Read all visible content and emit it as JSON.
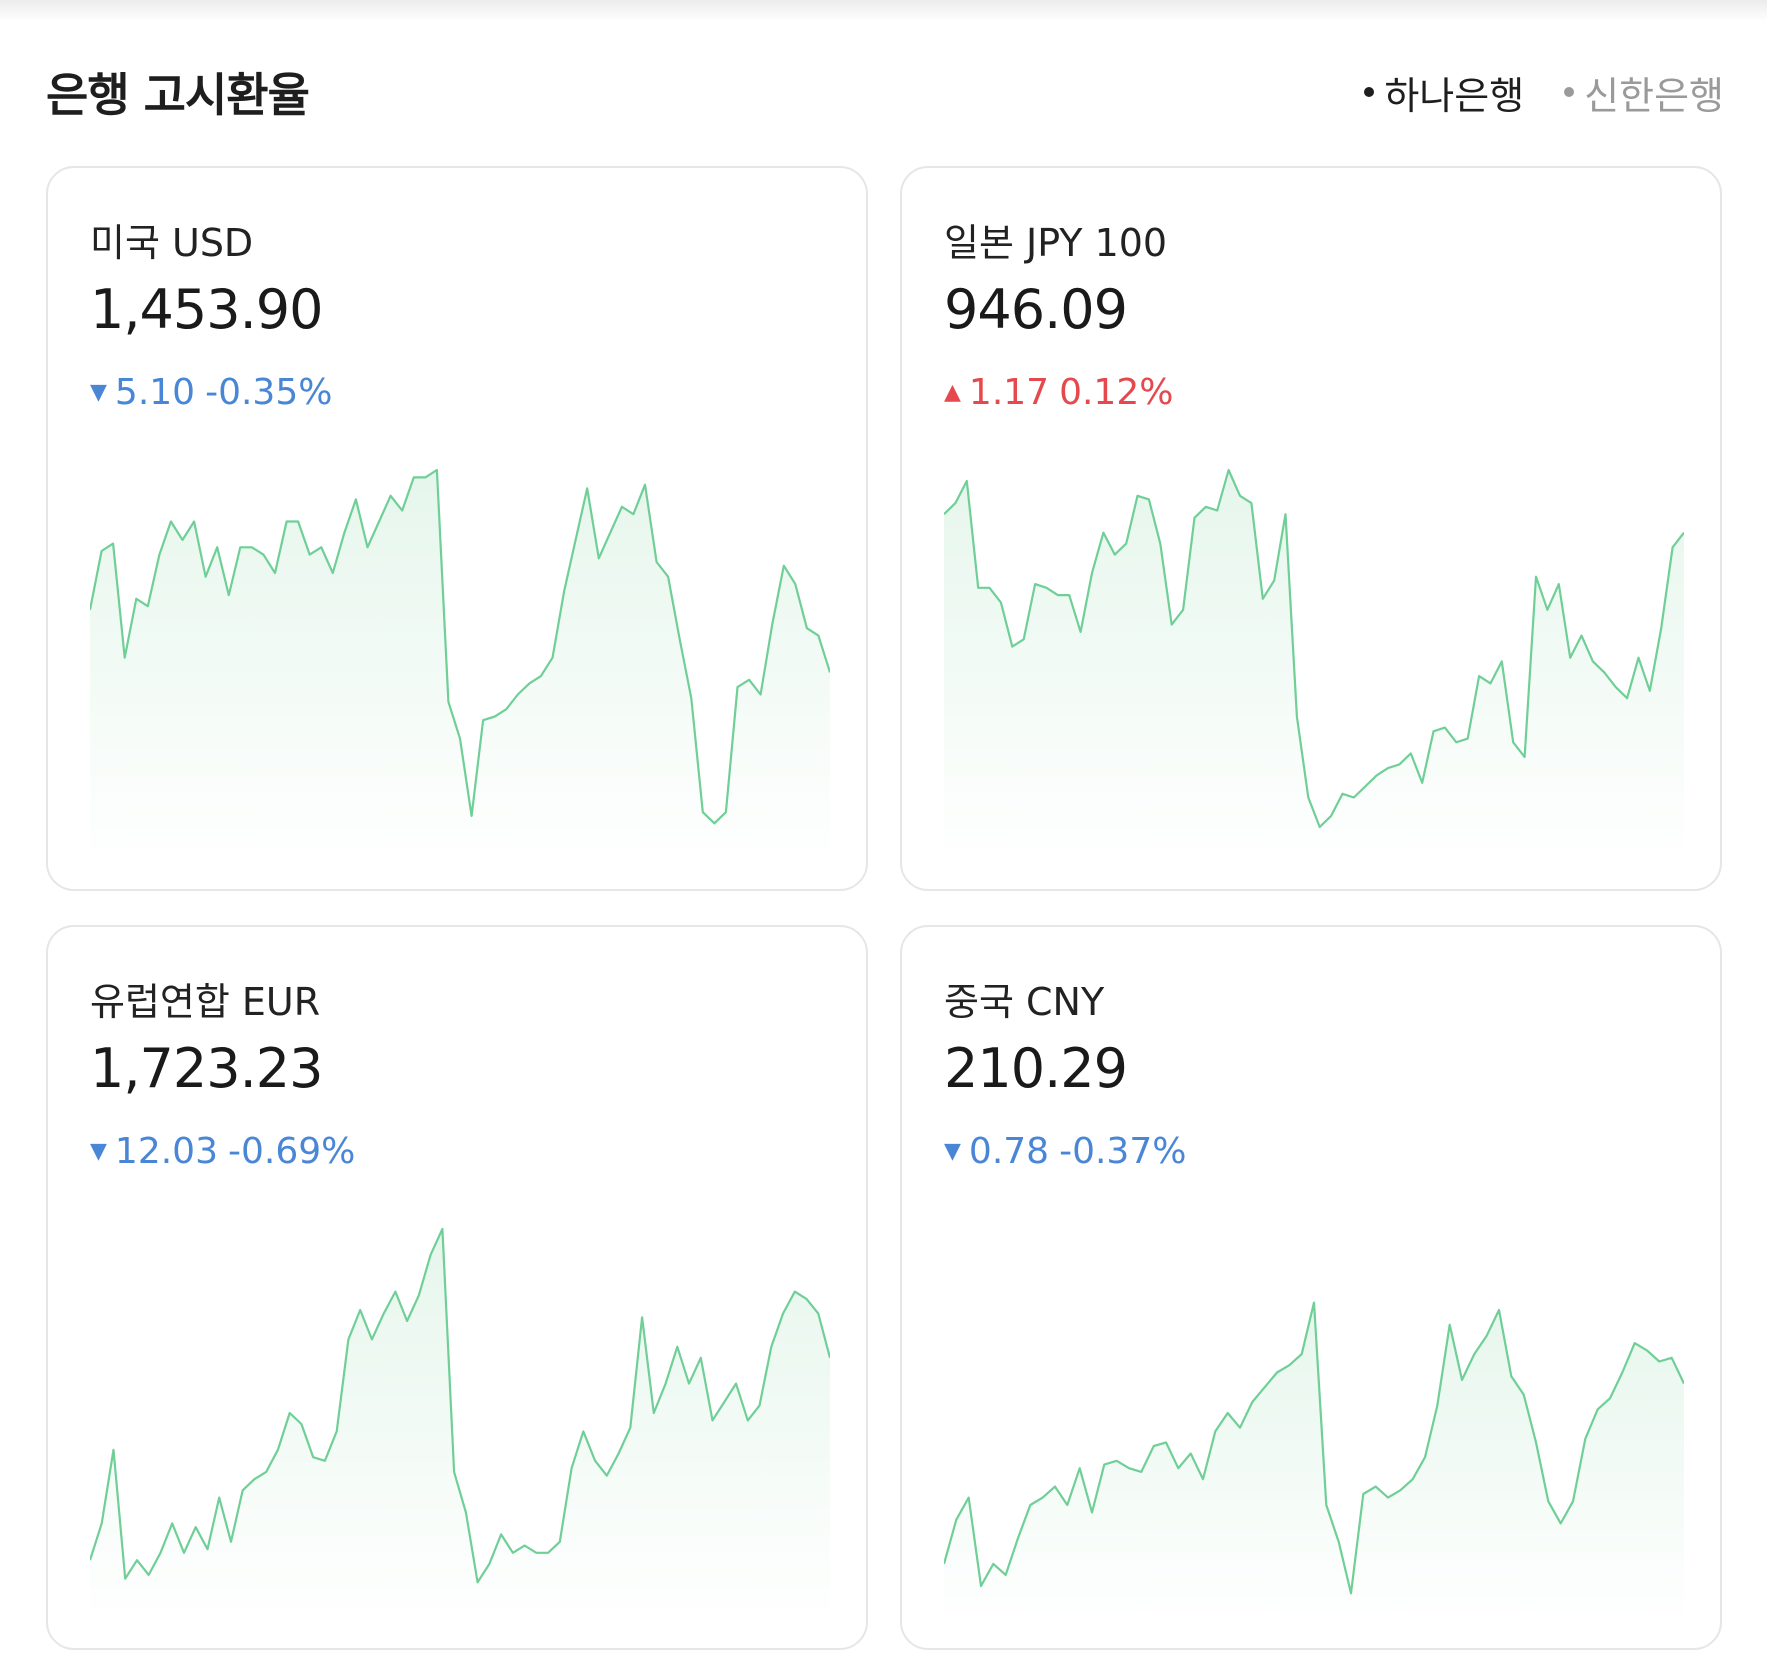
{
  "header": {
    "title": "은행 고시환율",
    "banks": [
      {
        "label": "하나은행",
        "active": true
      },
      {
        "label": "신한은행",
        "active": false
      }
    ]
  },
  "colors": {
    "down": "#4a86d6",
    "up": "#e5484d",
    "line": "#6fcf97",
    "fill": "#e6f6ec"
  },
  "cards": [
    {
      "name": "미국 USD",
      "rate": "1,453.90",
      "direction": "down",
      "arrow_icon": "triangle-down-icon",
      "diff": "5.10",
      "pct": "-0.35%",
      "series": [
        0.62,
        0.78,
        0.8,
        0.49,
        0.65,
        0.63,
        0.77,
        0.86,
        0.81,
        0.86,
        0.71,
        0.79,
        0.66,
        0.79,
        0.79,
        0.77,
        0.72,
        0.86,
        0.86,
        0.77,
        0.79,
        0.72,
        0.83,
        0.92,
        0.79,
        0.86,
        0.93,
        0.89,
        0.98,
        0.98,
        1.0,
        0.37,
        0.27,
        0.06,
        0.32,
        0.33,
        0.35,
        0.39,
        0.42,
        0.44,
        0.49,
        0.67,
        0.81,
        0.95,
        0.76,
        0.83,
        0.9,
        0.88,
        0.96,
        0.75,
        0.71,
        0.54,
        0.38,
        0.07,
        0.04,
        0.07,
        0.41,
        0.43,
        0.39,
        0.58,
        0.74,
        0.69,
        0.57,
        0.55,
        0.45
      ]
    },
    {
      "name": "일본 JPY 100",
      "rate": "946.09",
      "direction": "up",
      "arrow_icon": "triangle-up-icon",
      "diff": "1.17",
      "pct": "0.12%",
      "series": [
        0.88,
        0.91,
        0.97,
        0.68,
        0.68,
        0.64,
        0.52,
        0.54,
        0.69,
        0.68,
        0.66,
        0.66,
        0.56,
        0.72,
        0.83,
        0.77,
        0.8,
        0.93,
        0.92,
        0.8,
        0.58,
        0.62,
        0.87,
        0.9,
        0.89,
        1.0,
        0.93,
        0.91,
        0.65,
        0.7,
        0.88,
        0.33,
        0.11,
        0.03,
        0.06,
        0.12,
        0.11,
        0.14,
        0.17,
        0.19,
        0.2,
        0.23,
        0.15,
        0.29,
        0.3,
        0.26,
        0.27,
        0.44,
        0.42,
        0.48,
        0.26,
        0.22,
        0.71,
        0.62,
        0.69,
        0.49,
        0.55,
        0.48,
        0.45,
        0.41,
        0.38,
        0.49,
        0.4,
        0.57,
        0.79,
        0.83
      ]
    },
    {
      "name": "유럽연합 EUR",
      "rate": "1,723.23",
      "direction": "down",
      "arrow_icon": "triangle-down-icon",
      "diff": "12.03",
      "pct": "-0.69%",
      "series": [
        0.1,
        0.2,
        0.4,
        0.05,
        0.1,
        0.06,
        0.12,
        0.2,
        0.12,
        0.19,
        0.13,
        0.27,
        0.15,
        0.29,
        0.32,
        0.34,
        0.4,
        0.5,
        0.47,
        0.38,
        0.37,
        0.45,
        0.7,
        0.78,
        0.7,
        0.77,
        0.83,
        0.75,
        0.82,
        0.93,
        1.0,
        0.34,
        0.23,
        0.04,
        0.09,
        0.17,
        0.12,
        0.14,
        0.12,
        0.12,
        0.15,
        0.35,
        0.45,
        0.37,
        0.33,
        0.39,
        0.46,
        0.76,
        0.5,
        0.58,
        0.68,
        0.58,
        0.65,
        0.48,
        0.53,
        0.58,
        0.48,
        0.52,
        0.68,
        0.77,
        0.83,
        0.81,
        0.77,
        0.65
      ]
    },
    {
      "name": "중국 CNY",
      "rate": "210.29",
      "direction": "down",
      "arrow_icon": "triangle-down-icon",
      "diff": "0.78",
      "pct": "-0.37%",
      "series": [
        0.09,
        0.21,
        0.27,
        0.03,
        0.09,
        0.06,
        0.16,
        0.25,
        0.27,
        0.3,
        0.25,
        0.35,
        0.23,
        0.36,
        0.37,
        0.35,
        0.34,
        0.41,
        0.42,
        0.35,
        0.39,
        0.32,
        0.45,
        0.5,
        0.46,
        0.53,
        0.57,
        0.61,
        0.63,
        0.66,
        0.8,
        0.25,
        0.15,
        0.01,
        0.28,
        0.3,
        0.27,
        0.29,
        0.32,
        0.38,
        0.52,
        0.74,
        0.59,
        0.66,
        0.71,
        0.78,
        0.6,
        0.55,
        0.42,
        0.26,
        0.2,
        0.26,
        0.43,
        0.51,
        0.54,
        0.61,
        0.69,
        0.67,
        0.64,
        0.65,
        0.58
      ]
    }
  ]
}
